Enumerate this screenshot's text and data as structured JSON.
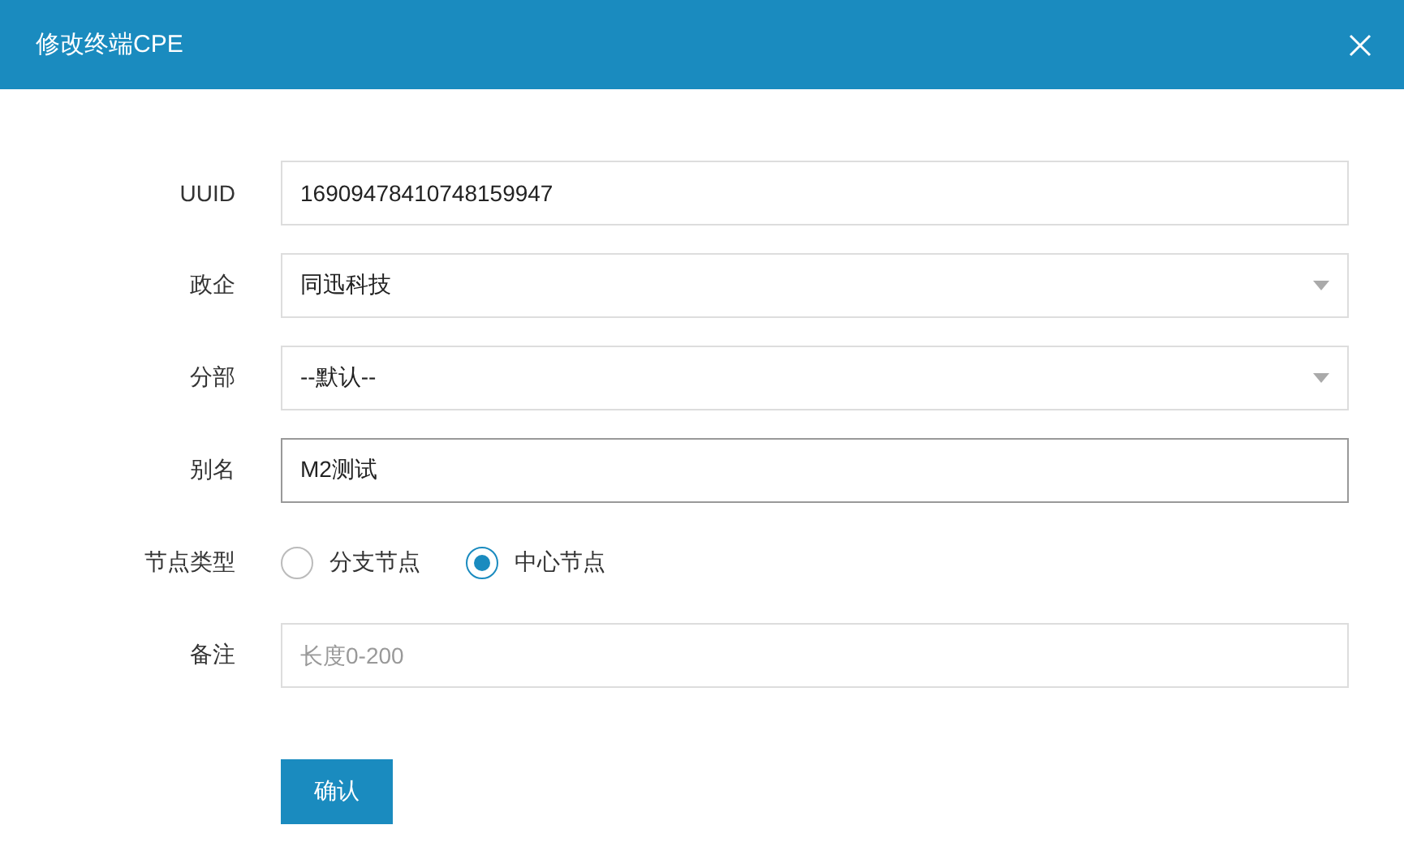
{
  "dialog": {
    "title": "修改终端CPE"
  },
  "fields": [
    {
      "label": "UUID",
      "kind": "text",
      "value": "16909478410748159947",
      "focused": false
    },
    {
      "label": "政企",
      "kind": "select",
      "value": "同迅科技"
    },
    {
      "label": "分部",
      "kind": "select",
      "value": "--默认--"
    },
    {
      "label": "别名",
      "kind": "text",
      "value": "M2测试",
      "focused": true
    },
    {
      "label": "节点类型",
      "kind": "radio",
      "options": [
        {
          "label": "分支节点",
          "selected": false
        },
        {
          "label": "中心节点",
          "selected": true
        }
      ]
    },
    {
      "label": "备注",
      "kind": "text",
      "placeholder": "长度0-200",
      "focused": false
    }
  ],
  "submit": "确认"
}
